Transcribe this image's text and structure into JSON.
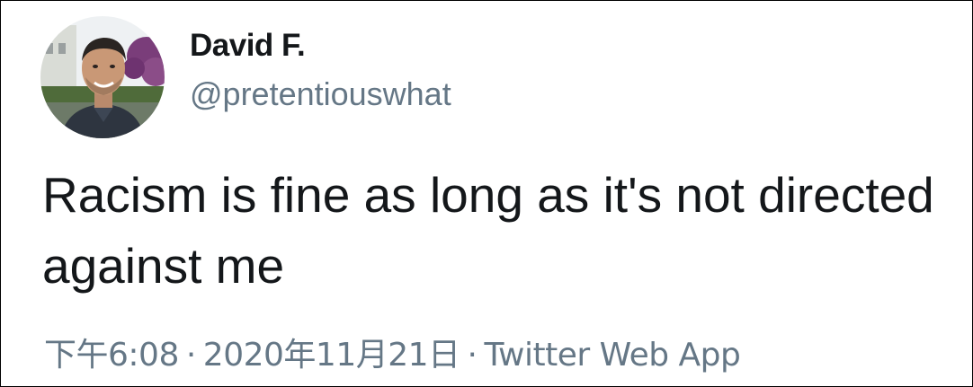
{
  "tweet": {
    "author": {
      "display_name": "David F.",
      "handle": "@pretentiouswhat",
      "avatar_icon": "profile-photo"
    },
    "text": "Racism is fine as long as it's not directed against me",
    "meta": {
      "time": "下午6:08",
      "separator": "·",
      "date": "2020年11月21日",
      "source": "Twitter Web App"
    }
  },
  "colors": {
    "primary_text": "#14171a",
    "secondary_text": "#657786",
    "background": "#ffffff",
    "border": "#000000"
  }
}
